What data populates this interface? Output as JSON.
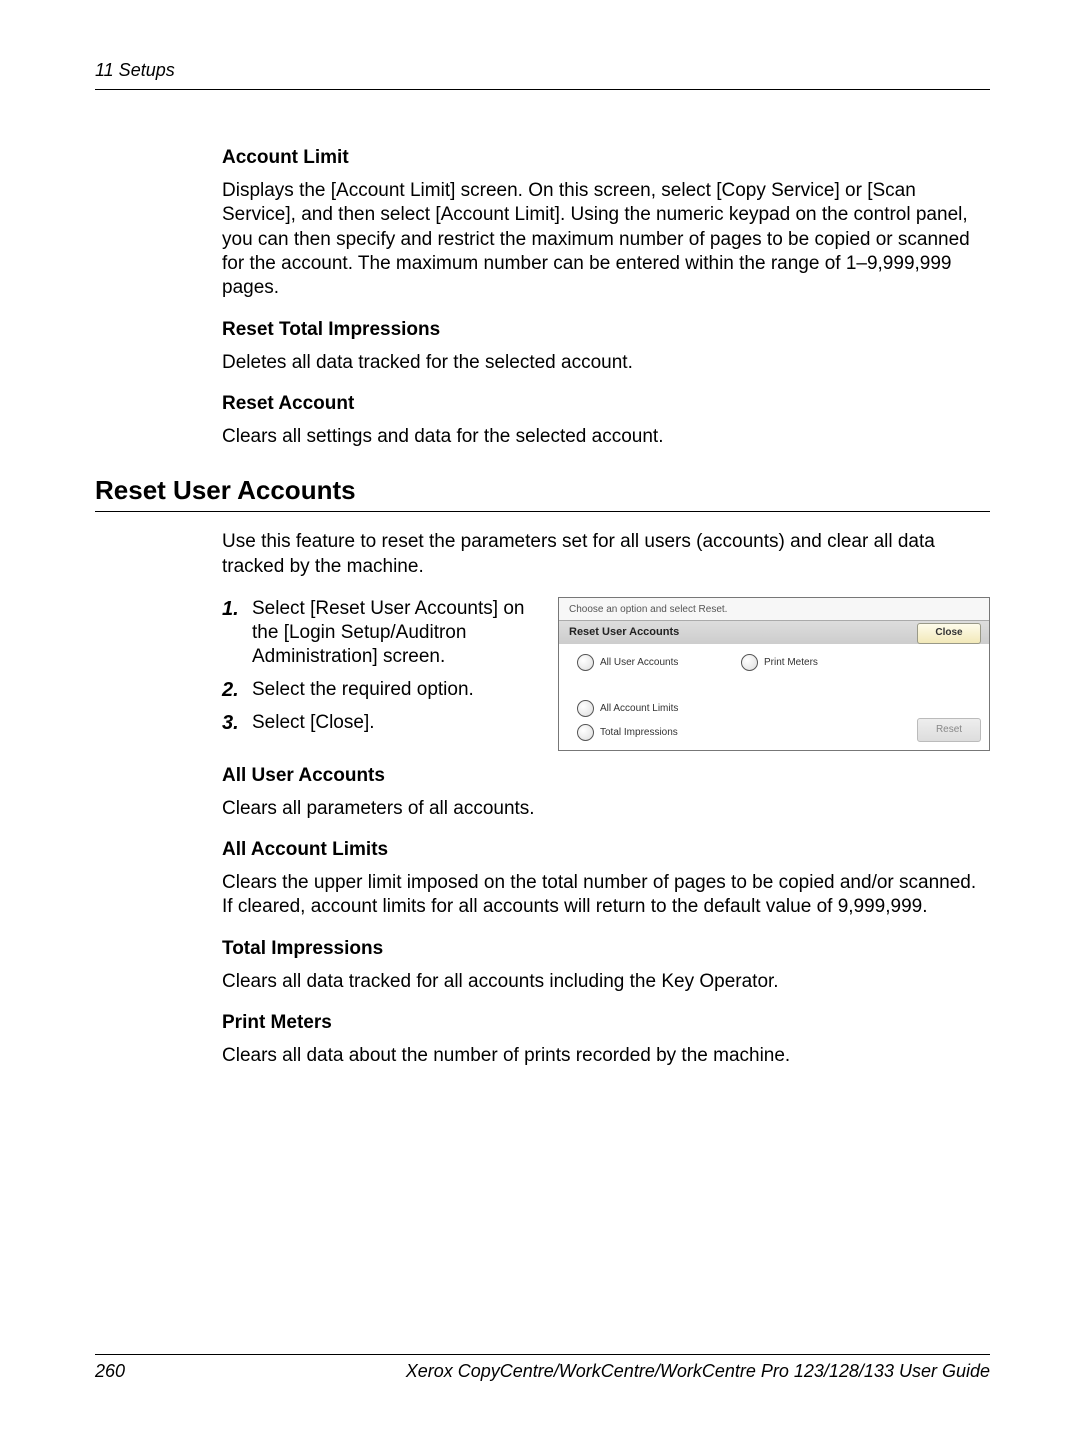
{
  "header": {
    "chapter": "11 Setups"
  },
  "sections": {
    "account_limit": {
      "heading": "Account Limit",
      "body": "Displays the [Account Limit] screen. On this screen, select [Copy Service] or [Scan Service], and then select [Account Limit]. Using the numeric keypad on the control panel, you can then specify and restrict the maximum number of pages to be copied or scanned for the account. The maximum number can be entered within the range of 1–9,999,999 pages."
    },
    "reset_total_impressions": {
      "heading": "Reset Total Impressions",
      "body": "Deletes all data tracked for the selected account."
    },
    "reset_account": {
      "heading": "Reset Account",
      "body": "Clears all settings and data for the selected account."
    },
    "reset_user_accounts": {
      "heading": "Reset User Accounts",
      "intro": "Use this feature to reset the parameters set for all users (accounts) and clear all data tracked by the machine.",
      "steps": [
        "Select [Reset User Accounts] on the  [Login Setup/Auditron Administration] screen.",
        "Select the required option.",
        "Select [Close]."
      ],
      "step_numbers": [
        "1.",
        "2.",
        "3."
      ]
    },
    "all_user_accounts": {
      "heading": "All User Accounts",
      "body": "Clears all parameters of all accounts."
    },
    "all_account_limits": {
      "heading": "All Account Limits",
      "body": "Clears the upper limit imposed on the total number of pages to be copied and/or scanned. If cleared, account limits for all accounts will return to the default value of 9,999,999."
    },
    "total_impressions": {
      "heading": "Total Impressions",
      "body": "Clears all data tracked for all accounts including the Key Operator."
    },
    "print_meters": {
      "heading": "Print Meters",
      "body": "Clears all data about the number of prints recorded by the machine."
    }
  },
  "screenshot": {
    "hint": "Choose an option and select Reset.",
    "title": "Reset User Accounts",
    "close": "Close",
    "options": {
      "all_user_accounts": "All User Accounts",
      "print_meters": "Print Meters",
      "all_account_limits": "All Account Limits",
      "total_impressions": "Total Impressions"
    },
    "reset": "Reset"
  },
  "footer": {
    "page": "260",
    "book": "Xerox CopyCentre/WorkCentre/WorkCentre Pro 123/128/133 User Guide"
  }
}
